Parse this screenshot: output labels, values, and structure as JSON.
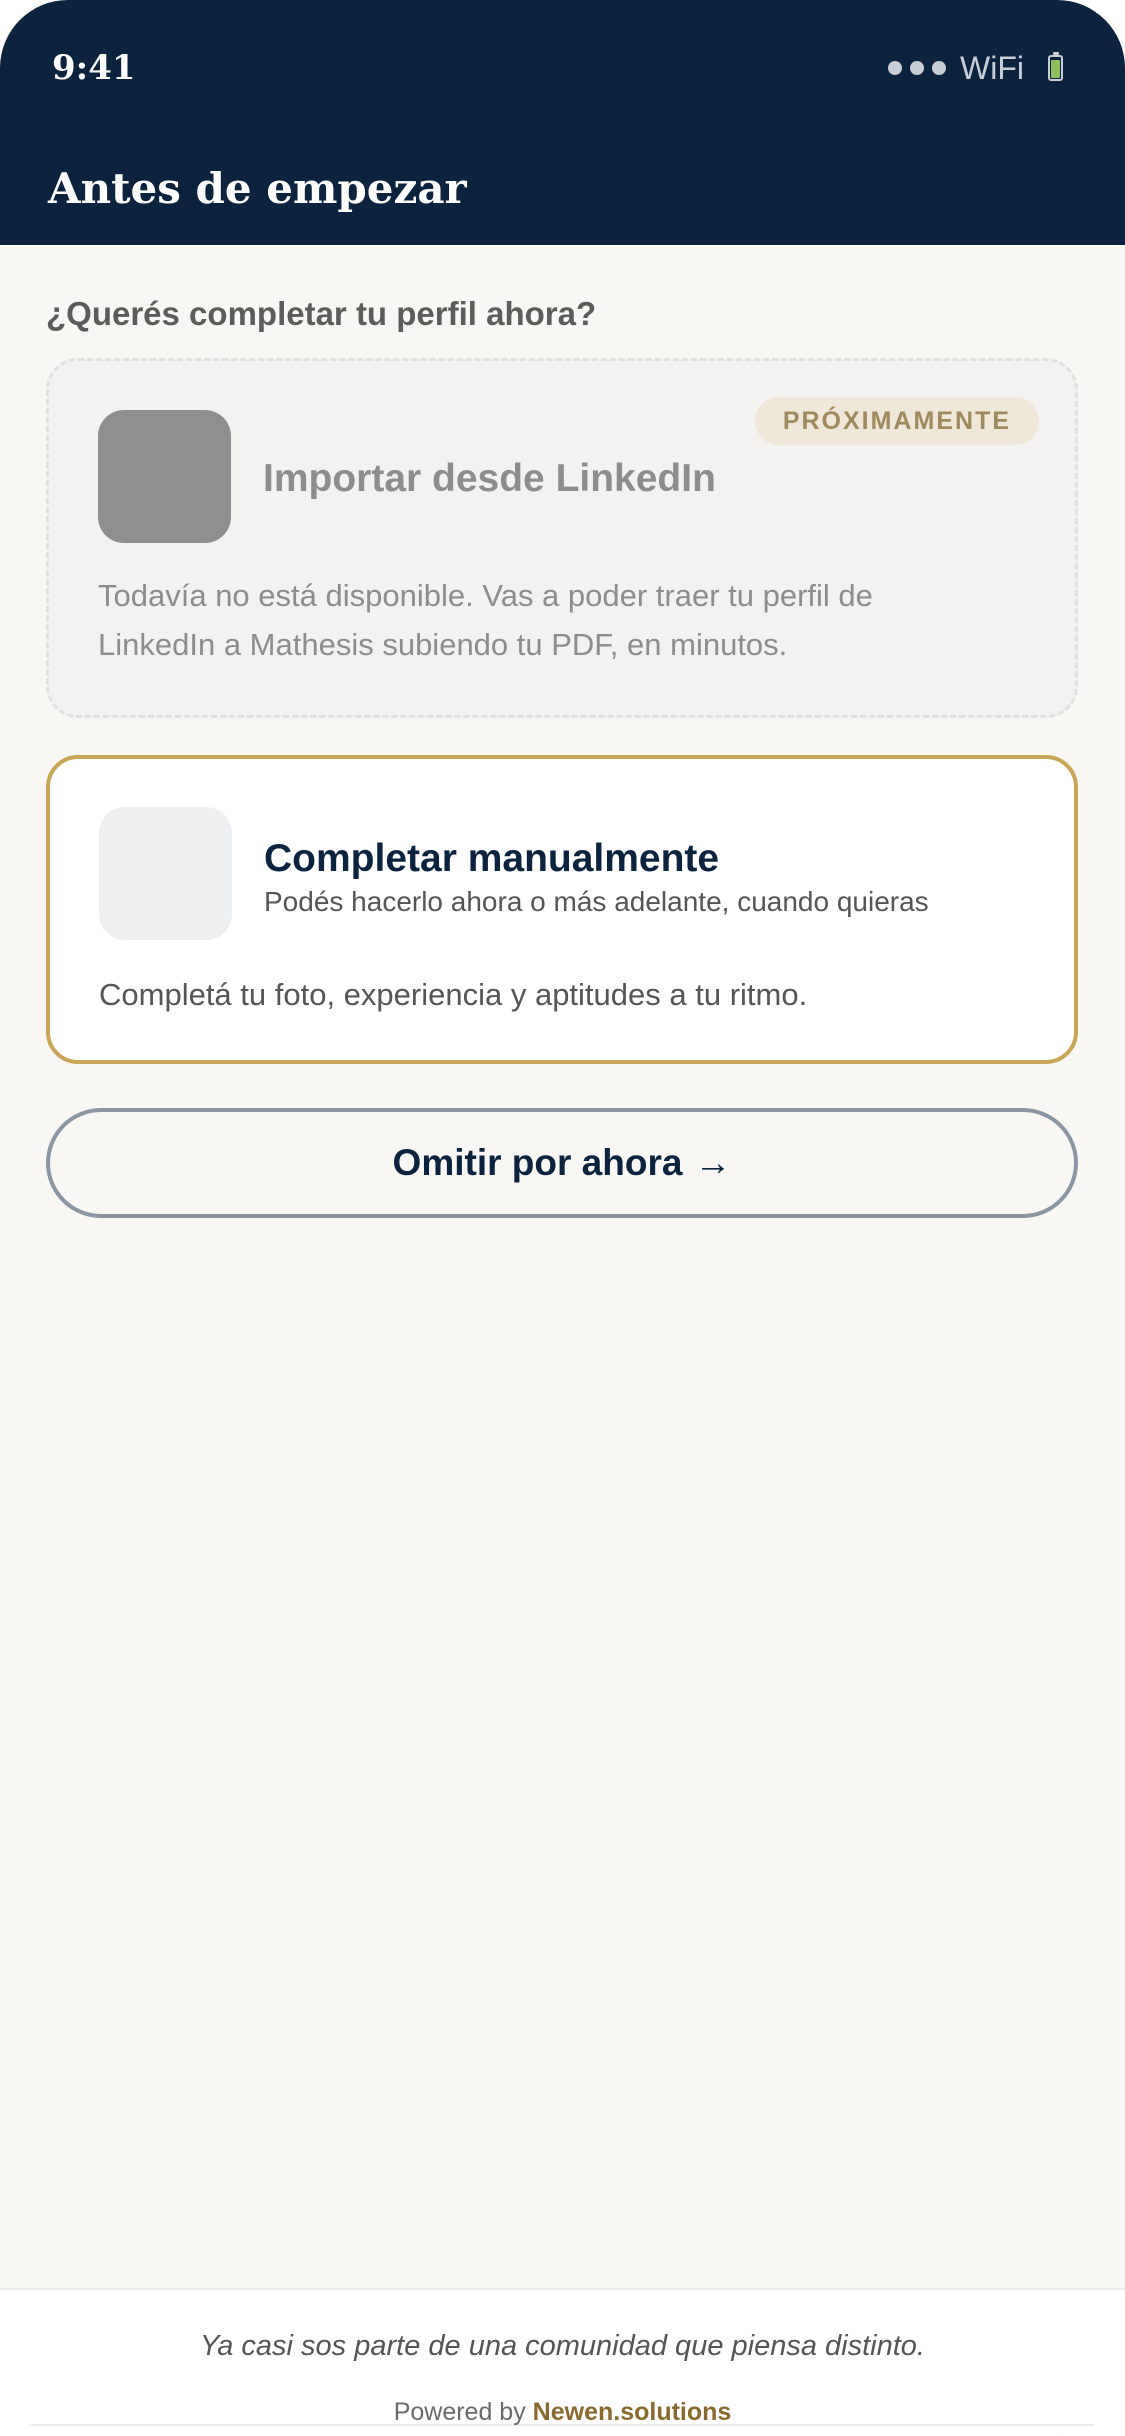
{
  "status_bar": {
    "time": "9:41",
    "wifi_label": "WiFi",
    "icons": [
      "signal-dots-icon",
      "battery-icon"
    ]
  },
  "header": {
    "title": "Antes de empezar"
  },
  "main": {
    "question": "¿Querés completar tu perfil ahora?",
    "linkedin_card": {
      "badge": "PRÓXIMAMENTE",
      "title": "Importar desde LinkedIn",
      "description": "Todavía no está disponible. Vas a poder traer tu perfil de LinkedIn a Mathesis subiendo tu PDF, en minutos."
    },
    "manual_card": {
      "title": "Completar manualmente",
      "subtitle": "Podés hacerlo ahora o más adelante, cuando quieras",
      "description": "Completá tu foto, experiencia y aptitudes a tu ritmo."
    },
    "skip_button": {
      "label": "Omitir por ahora",
      "arrow": "→"
    }
  },
  "footer": {
    "tagline": "Ya casi sos parte de una comunidad que piensa distinto.",
    "powered_prefix": "Powered by",
    "brand": "Newen.solutions"
  },
  "colors": {
    "header_bg": "#0b233f",
    "accent_gold": "#c9a655",
    "page_bg": "#f8f7f4"
  }
}
